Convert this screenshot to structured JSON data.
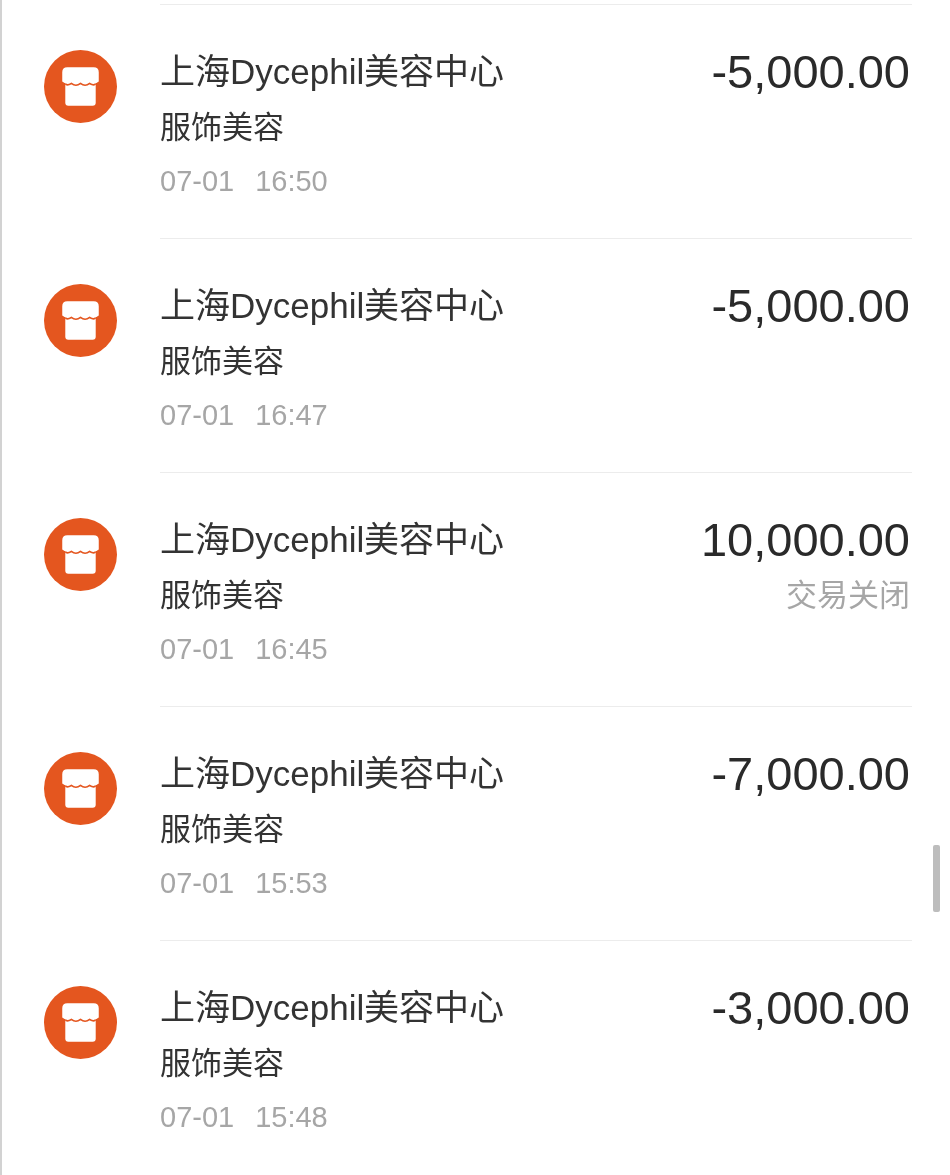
{
  "transactions": [
    {
      "merchant": "上海Dycephil美容中心",
      "category": "服饰美容",
      "date": "07-01",
      "time": "16:50",
      "amount": "-5,000.00"
    },
    {
      "merchant": "上海Dycephil美容中心",
      "category": "服饰美容",
      "date": "07-01",
      "time": "16:47",
      "amount": "-5,000.00"
    },
    {
      "merchant": "上海Dycephil美容中心",
      "category": "服饰美容",
      "date": "07-01",
      "time": "16:45",
      "amount": "10,000.00",
      "status": "交易关闭"
    },
    {
      "merchant": "上海Dycephil美容中心",
      "category": "服饰美容",
      "date": "07-01",
      "time": "15:53",
      "amount": "-7,000.00"
    },
    {
      "merchant": "上海Dycephil美容中心",
      "category": "服饰美容",
      "date": "07-01",
      "time": "15:48",
      "amount": "-3,000.00"
    }
  ]
}
